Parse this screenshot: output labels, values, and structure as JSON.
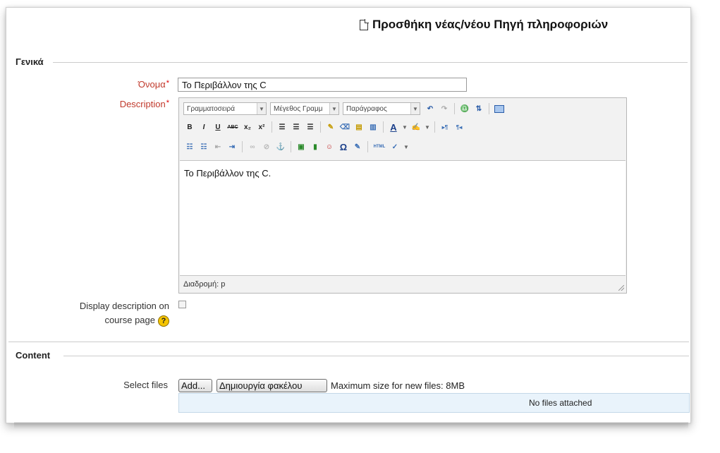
{
  "header": {
    "title": "Προσθήκη νέας/νέου Πηγή πληροφοριών",
    "icon": "document-icon"
  },
  "general": {
    "legend": "Γενικά",
    "name_label": "Όνομα",
    "name_value": "Το Περιβάλλον της C",
    "description_label": "Description",
    "required_marker": "*",
    "editor": {
      "font_family": "Γραμματοσειρά",
      "font_size": "Μέγεθος Γραμμ",
      "paragraph": "Παράγραφος",
      "content": "Το Περιβάλλον της C.",
      "path": "Διαδρομή: p",
      "toolbar_row1": [
        "undo-icon",
        "redo-icon",
        "find-icon",
        "replace-icon",
        "fullscreen-icon"
      ],
      "toolbar_row2": [
        "B",
        "I",
        "U",
        "ABC",
        "x₂",
        "x²"
      ],
      "toolbar_row3": [
        "list-bullets-icon",
        "list-numbers-icon",
        "outdent-icon",
        "indent-icon",
        "link-icon",
        "unlink-icon",
        "anchor-icon",
        "image-icon",
        "media-icon",
        "smiley-icon",
        "omega-icon",
        "edit-icon",
        "html-icon",
        "spellcheck-icon"
      ]
    },
    "display_description_label_1": "Display description on",
    "display_description_label_2": "course page",
    "help_glyph": "?"
  },
  "content": {
    "legend": "Content",
    "select_files_label": "Select files",
    "add_button": "Add...",
    "create_folder_button": "Δημιουργία φακέλου",
    "max_size": "Maximum size for new files: 8MB",
    "no_files": "No files attached"
  },
  "colors": {
    "required_label": "#c0392b",
    "files_box": "#e9f3fb"
  }
}
